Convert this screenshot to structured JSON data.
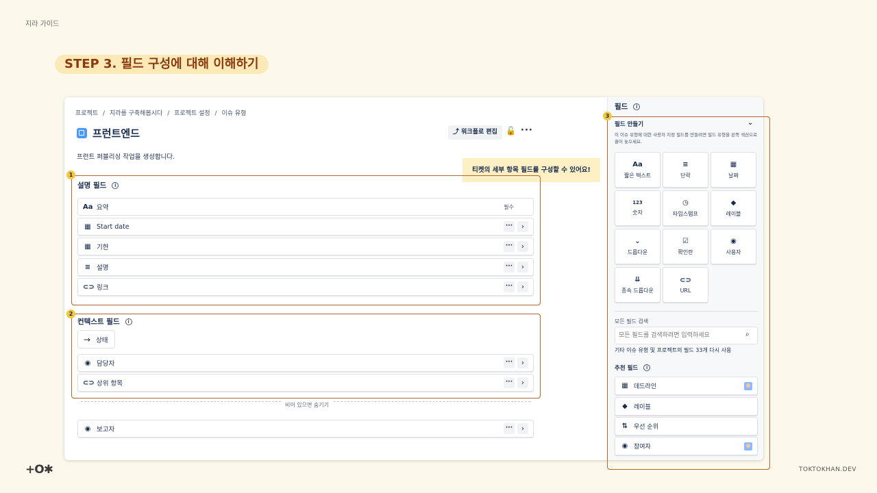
{
  "guide_label": "지라 가이드",
  "step_title": "STEP 3. 필드 구성에 대해 이해하기",
  "breadcrumb": [
    "프로젝트",
    "/",
    "지라를 구축해봅시다",
    "/",
    "프로젝트 설정",
    "/",
    "이슈 유형"
  ],
  "page_title": "프런트엔드",
  "workflow_button": "워크플로 편집",
  "description": "프런트 퍼블리싱 작업을 생성합니다.",
  "tooltip": "티켓의 세부 항목 필드를 구성할 수 있어요!",
  "description_fields": {
    "badge": "1",
    "title": "설명 필드",
    "rows": [
      {
        "icon": "Aa",
        "label": "요약",
        "required": "필수"
      },
      {
        "icon": "▦",
        "label": "Start date"
      },
      {
        "icon": "▦",
        "label": "기한"
      },
      {
        "icon": "≡",
        "label": "설명"
      },
      {
        "icon": "⊂⊃",
        "label": "링크"
      }
    ]
  },
  "context_fields": {
    "badge": "2",
    "title": "컨텍스트 필드",
    "state_button": "상태",
    "rows": [
      {
        "icon": "◉",
        "label": "담당자"
      },
      {
        "icon": "⊂⊃",
        "label": "상위 항목"
      }
    ]
  },
  "hide_when_empty": "비어 있으면 숨기기",
  "reporter_row": {
    "icon": "◉",
    "label": "보고자"
  },
  "row_more": "···",
  "row_chevron": "›",
  "header_more": "···",
  "info_glyph": "i",
  "right_panel": {
    "badge": "3",
    "title": "필드",
    "create_title": "필드 만들기",
    "create_desc": "이 이슈 유형에 대한 사용자 지정 필드를 만들려면 필드 유형을 왼쪽 섹션으로 끌어 놓으세요.",
    "tiles": [
      {
        "icon": "Aa",
        "label": "짧은 텍스트"
      },
      {
        "icon": "≡",
        "label": "단락"
      },
      {
        "icon": "▦",
        "label": "날짜"
      },
      {
        "icon": "123",
        "label": "숫자"
      },
      {
        "icon": "◷",
        "label": "타임스탬프"
      },
      {
        "icon": "◆",
        "label": "레이블"
      },
      {
        "icon": "⌄",
        "label": "드롭다운"
      },
      {
        "icon": "☑",
        "label": "확인란"
      },
      {
        "icon": "◉",
        "label": "사용자"
      },
      {
        "icon": "⇊",
        "label": "종속 드롭다운"
      },
      {
        "icon": "⊂⊃",
        "label": "URL"
      }
    ],
    "all_fields_label": "모든 필드 검색",
    "search_placeholder": "모든 필드를 검색하려면 입력하세요",
    "other_text": "기타 이슈 유형 및 프로젝트의 필드 33개 다시 사용",
    "recommended_title": "추천 필드",
    "recommended": [
      {
        "icon": "▦",
        "label": "데드라인",
        "avatar": true
      },
      {
        "icon": "◆",
        "label": "레이블",
        "avatar": false
      },
      {
        "icon": "⇅",
        "label": "우선 순위",
        "avatar": false
      },
      {
        "icon": "◉",
        "label": "참여자",
        "avatar": true
      }
    ]
  },
  "logo_text": "+O✱",
  "brand_text": "TOKTOKHAN.DEV"
}
